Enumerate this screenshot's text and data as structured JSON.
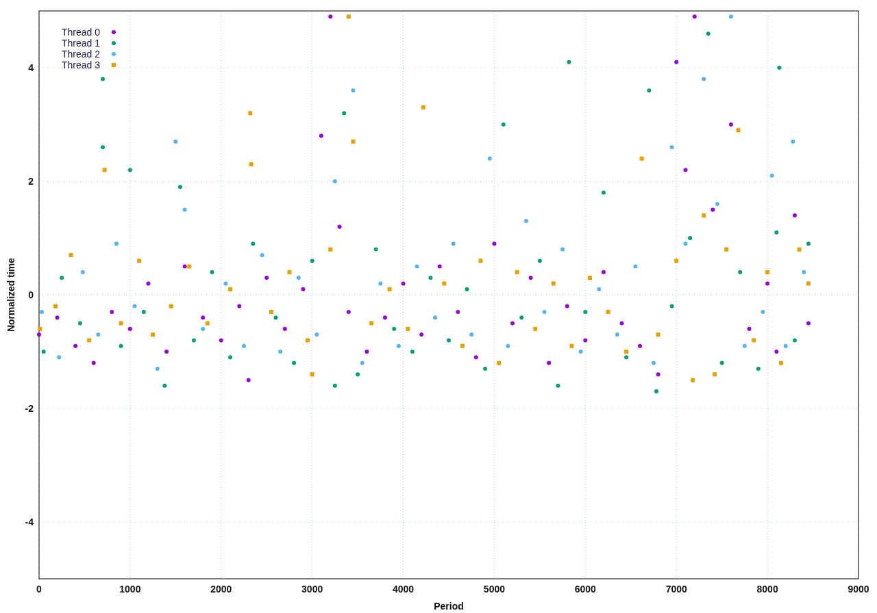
{
  "chart_data": {
    "type": "scatter",
    "xlabel": "Period",
    "ylabel": "Normalized time",
    "xlim": [
      0,
      9000
    ],
    "ylim": [
      -5,
      5
    ],
    "xticks": [
      0,
      1000,
      2000,
      3000,
      4000,
      5000,
      6000,
      7000,
      8000,
      9000
    ],
    "yticks": [
      -4,
      -2,
      0,
      2,
      4
    ],
    "grid": true,
    "legend": "top left",
    "series": [
      {
        "name": "Thread 0",
        "color": "#9400d3",
        "x": [
          0,
          200,
          400,
          600,
          800,
          1000,
          1200,
          1400,
          1600,
          1800,
          2000,
          2200,
          2300,
          2500,
          2700,
          2900,
          3100,
          3200,
          3300,
          3400,
          3600,
          3800,
          4000,
          4200,
          4400,
          4600,
          4800,
          5000,
          5200,
          5400,
          5600,
          5800,
          6000,
          6200,
          6400,
          6600,
          6800,
          7000,
          7100,
          7200,
          7400,
          7600,
          7800,
          8000,
          8100,
          8300,
          8450
        ],
        "values": [
          -0.7,
          -0.4,
          -0.9,
          -1.2,
          -0.3,
          -0.6,
          0.2,
          -1.0,
          0.5,
          -0.4,
          -0.8,
          -0.2,
          -1.5,
          0.3,
          -0.6,
          0.1,
          2.8,
          4.9,
          1.2,
          -0.3,
          -1.0,
          -0.4,
          0.2,
          -0.7,
          0.5,
          -0.3,
          -1.1,
          0.9,
          -0.5,
          0.3,
          -1.2,
          -0.2,
          -0.8,
          0.4,
          -0.5,
          -0.9,
          -1.4,
          4.1,
          2.2,
          4.9,
          1.5,
          3.0,
          -0.6,
          0.2,
          -1.0,
          1.4,
          -0.5
        ]
      },
      {
        "name": "Thread 1",
        "color": "#009e73",
        "x": [
          50,
          250,
          450,
          700,
          700,
          900,
          1000,
          1150,
          1380,
          1550,
          1700,
          1900,
          2100,
          2350,
          2600,
          2800,
          3000,
          3250,
          3350,
          3500,
          3700,
          3900,
          4100,
          4300,
          4500,
          4700,
          4900,
          5100,
          5300,
          5500,
          5700,
          5820,
          6000,
          6200,
          6450,
          6700,
          6780,
          6950,
          7150,
          7350,
          7500,
          7700,
          7900,
          8100,
          8130,
          8300,
          8450
        ],
        "values": [
          -1.0,
          0.3,
          -0.5,
          3.8,
          2.6,
          -0.9,
          2.2,
          -0.3,
          -1.6,
          1.9,
          -0.8,
          0.4,
          -1.1,
          0.9,
          -0.4,
          -1.2,
          0.6,
          -1.6,
          3.2,
          -1.4,
          0.8,
          -0.6,
          -1.0,
          0.3,
          -0.8,
          0.1,
          -1.3,
          3.0,
          -0.4,
          0.6,
          -1.6,
          4.1,
          -0.3,
          1.8,
          -1.1,
          3.6,
          -1.7,
          -0.2,
          1.0,
          4.6,
          -1.2,
          0.4,
          -1.3,
          1.1,
          4.0,
          -0.8,
          0.9
        ]
      },
      {
        "name": "Thread 2",
        "color": "#56b4e9",
        "x": [
          30,
          220,
          480,
          650,
          850,
          1050,
          1300,
          1500,
          1600,
          1800,
          2050,
          2250,
          2450,
          2650,
          2850,
          3050,
          3250,
          3450,
          3550,
          3750,
          3950,
          4150,
          4350,
          4550,
          4750,
          4950,
          5150,
          5350,
          5550,
          5750,
          5950,
          6150,
          6350,
          6550,
          6750,
          6950,
          7100,
          7300,
          7450,
          7600,
          7750,
          7950,
          8050,
          8200,
          8280,
          8400
        ],
        "values": [
          -0.3,
          -1.1,
          0.4,
          -0.7,
          0.9,
          -0.2,
          -1.3,
          2.7,
          1.5,
          -0.6,
          0.2,
          -0.9,
          0.7,
          -1.0,
          0.3,
          -0.7,
          2.0,
          3.6,
          -1.2,
          0.2,
          -0.9,
          0.5,
          -0.4,
          0.9,
          -0.7,
          2.4,
          -0.9,
          1.3,
          -0.3,
          0.8,
          -1.0,
          0.1,
          -0.7,
          0.5,
          -1.2,
          2.6,
          0.9,
          3.8,
          1.6,
          4.9,
          -0.9,
          -0.3,
          2.1,
          -0.9,
          2.7,
          0.4
        ]
      },
      {
        "name": "Thread 3",
        "color": "#e69f00",
        "x": [
          10,
          180,
          350,
          550,
          720,
          900,
          1100,
          1250,
          1450,
          1650,
          1850,
          2100,
          2320,
          2330,
          2550,
          2750,
          2950,
          3000,
          3200,
          3400,
          3450,
          3650,
          3850,
          4050,
          4220,
          4450,
          4650,
          4850,
          5050,
          5250,
          5450,
          5650,
          5850,
          6050,
          6250,
          6450,
          6620,
          6800,
          7000,
          7180,
          7300,
          7420,
          7550,
          7680,
          7850,
          8000,
          8150,
          8350,
          8450
        ],
        "values": [
          -0.6,
          -0.2,
          0.7,
          -0.8,
          2.2,
          -0.5,
          0.6,
          -0.7,
          -0.2,
          0.5,
          -0.5,
          0.1,
          3.2,
          2.3,
          -0.3,
          0.4,
          -0.8,
          -1.4,
          0.8,
          4.9,
          2.7,
          -0.5,
          0.1,
          -0.6,
          3.3,
          0.2,
          -0.9,
          0.6,
          -1.2,
          0.4,
          -0.6,
          0.2,
          -0.9,
          0.3,
          -0.3,
          -1.0,
          2.4,
          -0.7,
          0.6,
          -1.5,
          1.4,
          -1.4,
          0.8,
          2.9,
          -0.8,
          0.4,
          -1.2,
          0.8,
          0.2
        ]
      }
    ]
  }
}
